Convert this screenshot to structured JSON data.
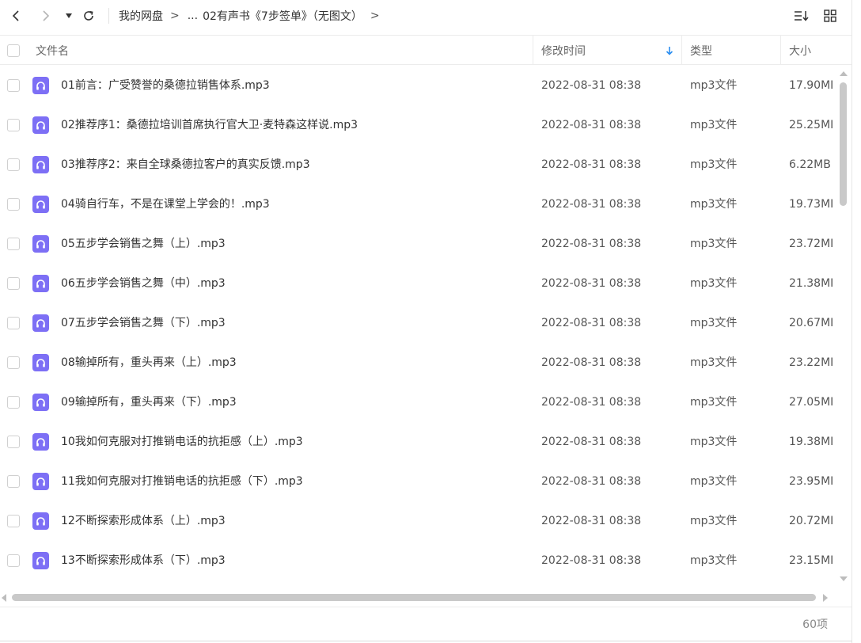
{
  "nav": {
    "breadcrumb": [
      "我的网盘",
      "...",
      "02有声书《7步签单》（无图文）"
    ],
    "separator": ">"
  },
  "colors": {
    "accent": "#2b8ef0",
    "file_icon": "#7d6ff5"
  },
  "columns": {
    "name": "文件名",
    "modified": "修改时间",
    "type": "类型",
    "size": "大小"
  },
  "sort": {
    "column": "modified",
    "direction": "desc"
  },
  "files": [
    {
      "name": "01前言：广受赞誉的桑德拉销售体系.mp3",
      "modified": "2022-08-31 08:38",
      "type": "mp3文件",
      "size": "17.90MI"
    },
    {
      "name": "02推荐序1：桑德拉培训首席执行官大卫·麦特森这样说.mp3",
      "modified": "2022-08-31 08:38",
      "type": "mp3文件",
      "size": "25.25MI"
    },
    {
      "name": "03推荐序2：来自全球桑德拉客户的真实反馈.mp3",
      "modified": "2022-08-31 08:38",
      "type": "mp3文件",
      "size": "6.22MB"
    },
    {
      "name": "04骑自行车，不是在课堂上学会的！.mp3",
      "modified": "2022-08-31 08:38",
      "type": "mp3文件",
      "size": "19.73MI"
    },
    {
      "name": "05五步学会销售之舞（上）.mp3",
      "modified": "2022-08-31 08:38",
      "type": "mp3文件",
      "size": "23.72MI"
    },
    {
      "name": "06五步学会销售之舞（中）.mp3",
      "modified": "2022-08-31 08:38",
      "type": "mp3文件",
      "size": "21.38MI"
    },
    {
      "name": "07五步学会销售之舞（下）.mp3",
      "modified": "2022-08-31 08:38",
      "type": "mp3文件",
      "size": "20.67MI"
    },
    {
      "name": "08输掉所有，重头再来（上）.mp3",
      "modified": "2022-08-31 08:38",
      "type": "mp3文件",
      "size": "23.22MI"
    },
    {
      "name": "09输掉所有，重头再来（下）.mp3",
      "modified": "2022-08-31 08:38",
      "type": "mp3文件",
      "size": "27.05MI"
    },
    {
      "name": "10我如何克服对打推销电话的抗拒感（上）.mp3",
      "modified": "2022-08-31 08:38",
      "type": "mp3文件",
      "size": "19.38MI"
    },
    {
      "name": "11我如何克服对打推销电话的抗拒感（下）.mp3",
      "modified": "2022-08-31 08:38",
      "type": "mp3文件",
      "size": "23.95MI"
    },
    {
      "name": "12不断探索形成体系（上）.mp3",
      "modified": "2022-08-31 08:38",
      "type": "mp3文件",
      "size": "20.72MI"
    },
    {
      "name": "13不断探索形成体系（下）.mp3",
      "modified": "2022-08-31 08:38",
      "type": "mp3文件",
      "size": "23.15MI"
    }
  ],
  "footer": {
    "item_count": "60项"
  }
}
